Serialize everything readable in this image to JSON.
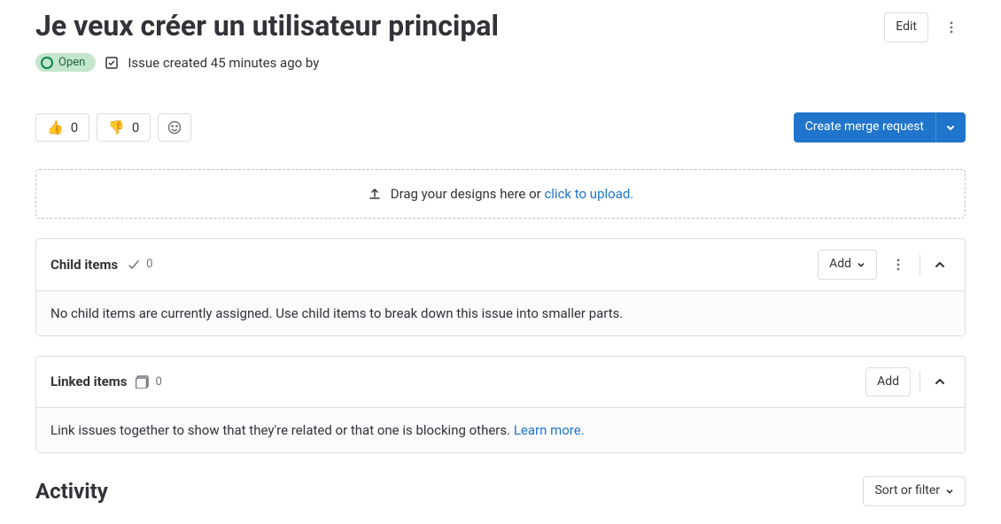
{
  "issue": {
    "title": "Je veux créer un utilisateur principal",
    "status": "Open",
    "created_text": "Issue created 45 minutes ago by"
  },
  "header_actions": {
    "edit": "Edit"
  },
  "reactions": {
    "thumbs_up_count": "0",
    "thumbs_down_count": "0"
  },
  "merge_request": {
    "create_label": "Create merge request"
  },
  "dropzone": {
    "prefix": "Drag your designs here or ",
    "link": "click to upload."
  },
  "child_items": {
    "title": "Child items",
    "count": "0",
    "add": "Add",
    "empty": "No child items are currently assigned. Use child items to break down this issue into smaller parts."
  },
  "linked_items": {
    "title": "Linked items",
    "count": "0",
    "add": "Add",
    "body_text": "Link issues together to show that they're related or that one is blocking others. ",
    "learn_more": "Learn more."
  },
  "activity": {
    "title": "Activity",
    "sort_filter": "Sort or filter"
  }
}
